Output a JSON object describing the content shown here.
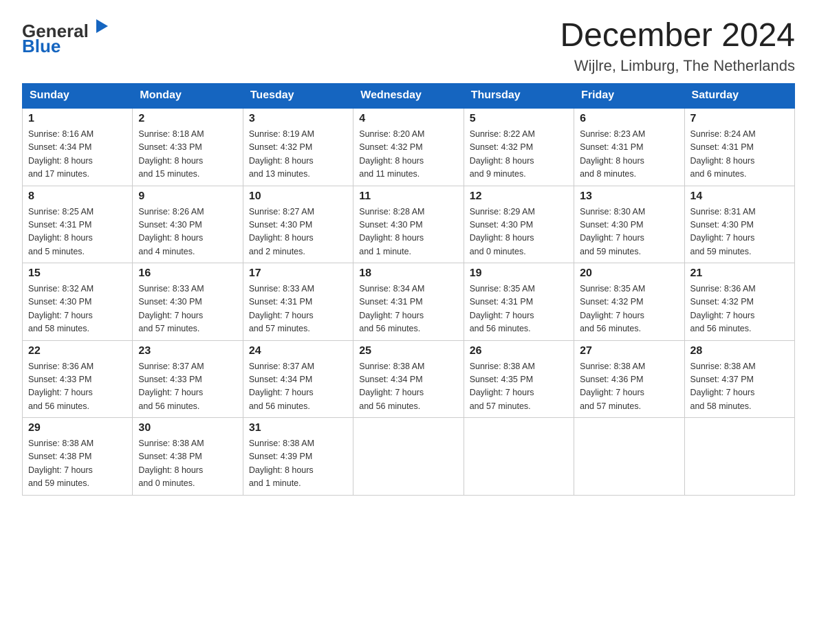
{
  "header": {
    "logo_general": "General",
    "logo_blue": "Blue",
    "title": "December 2024",
    "subtitle": "Wijlre, Limburg, The Netherlands"
  },
  "days_of_week": [
    "Sunday",
    "Monday",
    "Tuesday",
    "Wednesday",
    "Thursday",
    "Friday",
    "Saturday"
  ],
  "weeks": [
    [
      {
        "date": "1",
        "sunrise": "8:16 AM",
        "sunset": "4:34 PM",
        "daylight": "8 hours and 17 minutes."
      },
      {
        "date": "2",
        "sunrise": "8:18 AM",
        "sunset": "4:33 PM",
        "daylight": "8 hours and 15 minutes."
      },
      {
        "date": "3",
        "sunrise": "8:19 AM",
        "sunset": "4:32 PM",
        "daylight": "8 hours and 13 minutes."
      },
      {
        "date": "4",
        "sunrise": "8:20 AM",
        "sunset": "4:32 PM",
        "daylight": "8 hours and 11 minutes."
      },
      {
        "date": "5",
        "sunrise": "8:22 AM",
        "sunset": "4:32 PM",
        "daylight": "8 hours and 9 minutes."
      },
      {
        "date": "6",
        "sunrise": "8:23 AM",
        "sunset": "4:31 PM",
        "daylight": "8 hours and 8 minutes."
      },
      {
        "date": "7",
        "sunrise": "8:24 AM",
        "sunset": "4:31 PM",
        "daylight": "8 hours and 6 minutes."
      }
    ],
    [
      {
        "date": "8",
        "sunrise": "8:25 AM",
        "sunset": "4:31 PM",
        "daylight": "8 hours and 5 minutes."
      },
      {
        "date": "9",
        "sunrise": "8:26 AM",
        "sunset": "4:30 PM",
        "daylight": "8 hours and 4 minutes."
      },
      {
        "date": "10",
        "sunrise": "8:27 AM",
        "sunset": "4:30 PM",
        "daylight": "8 hours and 2 minutes."
      },
      {
        "date": "11",
        "sunrise": "8:28 AM",
        "sunset": "4:30 PM",
        "daylight": "8 hours and 1 minute."
      },
      {
        "date": "12",
        "sunrise": "8:29 AM",
        "sunset": "4:30 PM",
        "daylight": "8 hours and 0 minutes."
      },
      {
        "date": "13",
        "sunrise": "8:30 AM",
        "sunset": "4:30 PM",
        "daylight": "7 hours and 59 minutes."
      },
      {
        "date": "14",
        "sunrise": "8:31 AM",
        "sunset": "4:30 PM",
        "daylight": "7 hours and 59 minutes."
      }
    ],
    [
      {
        "date": "15",
        "sunrise": "8:32 AM",
        "sunset": "4:30 PM",
        "daylight": "7 hours and 58 minutes."
      },
      {
        "date": "16",
        "sunrise": "8:33 AM",
        "sunset": "4:30 PM",
        "daylight": "7 hours and 57 minutes."
      },
      {
        "date": "17",
        "sunrise": "8:33 AM",
        "sunset": "4:31 PM",
        "daylight": "7 hours and 57 minutes."
      },
      {
        "date": "18",
        "sunrise": "8:34 AM",
        "sunset": "4:31 PM",
        "daylight": "7 hours and 56 minutes."
      },
      {
        "date": "19",
        "sunrise": "8:35 AM",
        "sunset": "4:31 PM",
        "daylight": "7 hours and 56 minutes."
      },
      {
        "date": "20",
        "sunrise": "8:35 AM",
        "sunset": "4:32 PM",
        "daylight": "7 hours and 56 minutes."
      },
      {
        "date": "21",
        "sunrise": "8:36 AM",
        "sunset": "4:32 PM",
        "daylight": "7 hours and 56 minutes."
      }
    ],
    [
      {
        "date": "22",
        "sunrise": "8:36 AM",
        "sunset": "4:33 PM",
        "daylight": "7 hours and 56 minutes."
      },
      {
        "date": "23",
        "sunrise": "8:37 AM",
        "sunset": "4:33 PM",
        "daylight": "7 hours and 56 minutes."
      },
      {
        "date": "24",
        "sunrise": "8:37 AM",
        "sunset": "4:34 PM",
        "daylight": "7 hours and 56 minutes."
      },
      {
        "date": "25",
        "sunrise": "8:38 AM",
        "sunset": "4:34 PM",
        "daylight": "7 hours and 56 minutes."
      },
      {
        "date": "26",
        "sunrise": "8:38 AM",
        "sunset": "4:35 PM",
        "daylight": "7 hours and 57 minutes."
      },
      {
        "date": "27",
        "sunrise": "8:38 AM",
        "sunset": "4:36 PM",
        "daylight": "7 hours and 57 minutes."
      },
      {
        "date": "28",
        "sunrise": "8:38 AM",
        "sunset": "4:37 PM",
        "daylight": "7 hours and 58 minutes."
      }
    ],
    [
      {
        "date": "29",
        "sunrise": "8:38 AM",
        "sunset": "4:38 PM",
        "daylight": "7 hours and 59 minutes."
      },
      {
        "date": "30",
        "sunrise": "8:38 AM",
        "sunset": "4:38 PM",
        "daylight": "8 hours and 0 minutes."
      },
      {
        "date": "31",
        "sunrise": "8:38 AM",
        "sunset": "4:39 PM",
        "daylight": "8 hours and 1 minute."
      },
      null,
      null,
      null,
      null
    ]
  ],
  "labels": {
    "sunrise": "Sunrise:",
    "sunset": "Sunset:",
    "daylight": "Daylight:"
  }
}
